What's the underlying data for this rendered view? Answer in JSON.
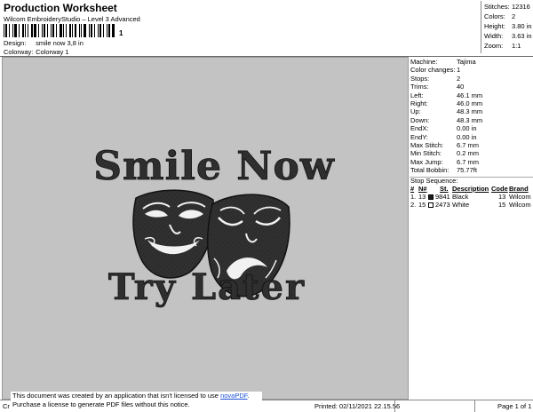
{
  "header": {
    "title": "Production Worksheet",
    "subtitle": "Wilcom EmbroideryStudio – Level 3 Advanced",
    "barcode_digit": "1"
  },
  "meta": [
    {
      "label": "Design:",
      "value": "smile now 3,8 in"
    },
    {
      "label": "Colorway:",
      "value": "Colorway 1"
    }
  ],
  "summary": [
    {
      "label": "Stitches:",
      "value": "12316"
    },
    {
      "label": "Colors:",
      "value": "2"
    },
    {
      "label": "Height:",
      "value": "3.80 in"
    },
    {
      "label": "Width:",
      "value": "3.63 in"
    },
    {
      "label": "Zoom:",
      "value": "1:1"
    }
  ],
  "design": {
    "line1": "Smile Now",
    "line2": "Try Later",
    "colors": {
      "thread": "#2a2a2a",
      "highlight": "#ffffff",
      "background": "#c3c3c3"
    }
  },
  "specs": [
    {
      "label": "Machine:",
      "value": "Tajima"
    },
    {
      "label": "Color changes:",
      "value": "1"
    },
    {
      "label": "Stops:",
      "value": "2"
    },
    {
      "label": "Trims:",
      "value": "40"
    },
    {
      "label": "Left:",
      "value": "46.1 mm"
    },
    {
      "label": "Right:",
      "value": "46.0 mm"
    },
    {
      "label": "Up:",
      "value": "48.3 mm"
    },
    {
      "label": "Down:",
      "value": "48.3 mm"
    },
    {
      "label": "EndX:",
      "value": "0.00 in"
    },
    {
      "label": "EndY:",
      "value": "0.00 in"
    },
    {
      "label": "Max Stitch:",
      "value": "6.7 mm"
    },
    {
      "label": "Min Stitch:",
      "value": "0.2 mm"
    },
    {
      "label": "Max Jump:",
      "value": "6.7 mm"
    },
    {
      "label": "Total Bobbin:",
      "value": "75.77ft"
    }
  ],
  "stop_sequence": {
    "title": "Stop Sequence:",
    "headers": [
      "#",
      "N#",
      "St.",
      "Description",
      "Code",
      "Brand"
    ],
    "rows": [
      {
        "idx": "1.",
        "n": "13",
        "swatch": "#1a1a1a",
        "st": "9841",
        "desc": "Black",
        "code": "13",
        "brand": "Wilcom"
      },
      {
        "idx": "2.",
        "n": "15",
        "swatch": "#ffffff",
        "st": "2473",
        "desc": "White",
        "code": "15",
        "brand": "Wilcom"
      }
    ]
  },
  "footer": {
    "cr": "Cr",
    "notice_line1_prefix": "This document was created by an application that isn't licensed to use ",
    "notice_link": "novaPDF",
    "notice_line1_suffix": ".",
    "notice_line2": "Purchase a license to generate PDF files without this notice.",
    "printed": "Printed: 02/11/2021 22.15.56",
    "page": "Page 1 of 1"
  }
}
